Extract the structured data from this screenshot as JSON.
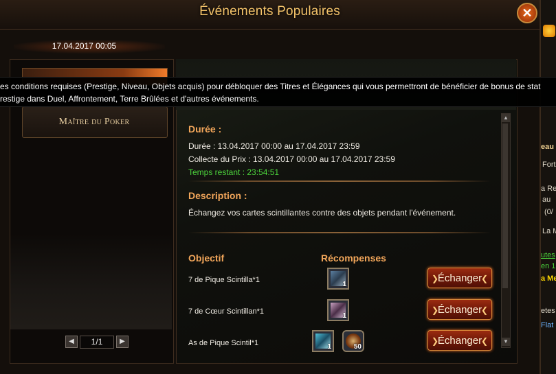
{
  "window": {
    "title": "Événements Populaires",
    "close_glyph": "✕",
    "date": "17.04.2017 00:05"
  },
  "tooltip": {
    "line1": "es conditions requises (Prestige, Niveau, Objets acquis) pour débloquer des Titres et Élégances qui vous permettront de bénéficier de bonus de stat",
    "line2": "restige dans Duel, Affrontement, Terre Brûlées et d'autres événements."
  },
  "events_list": {
    "items": [
      {
        "label": ""
      },
      {
        "label": "Maître du Poker"
      }
    ],
    "pager": {
      "prev_glyph": "◀",
      "value": "1/1",
      "next_glyph": "▶"
    }
  },
  "details": {
    "duration": {
      "heading": "Durée :",
      "line1": "Durée : 13.04.2017 00:00 au 17.04.2017 23:59",
      "line2": "Collecte du Prix : 13.04.2017 00:00 au 17.04.2017 23:59",
      "remaining": "Temps restant : 23:54:51"
    },
    "description": {
      "heading": "Description :",
      "text": "Échangez vos cartes scintillantes contre des objets pendant l'événement."
    },
    "table": {
      "objective_header": "Objectif",
      "rewards_header": "Récompenses",
      "rows": [
        {
          "objective": "7 de Pique Scintilla*1",
          "rewards": [
            {
              "qty": "1",
              "icon": "item-icon"
            }
          ],
          "button": "Échanger"
        },
        {
          "objective": "7 de Cœur Scintillan*1",
          "rewards": [
            {
              "qty": "1",
              "icon": "item-icon"
            }
          ],
          "button": "Échanger"
        },
        {
          "objective": "As de Pique Scintil*1",
          "rewards": [
            {
              "qty": "1",
              "icon": "item-icon"
            },
            {
              "qty": "50",
              "icon": "item-icon"
            }
          ],
          "button": "Échanger"
        }
      ]
    }
  },
  "background_ui": {
    "texts": [
      "eau",
      "Fort",
      "a Re",
      "au",
      "(0/",
      "La M",
      "utes",
      "en 1",
      "a Me",
      "etes",
      "Flat"
    ]
  },
  "colors": {
    "accent": "#f2a65a",
    "title": "#f4c36a",
    "remaining_time": "#4cd43c",
    "button": "#9a2b10"
  }
}
